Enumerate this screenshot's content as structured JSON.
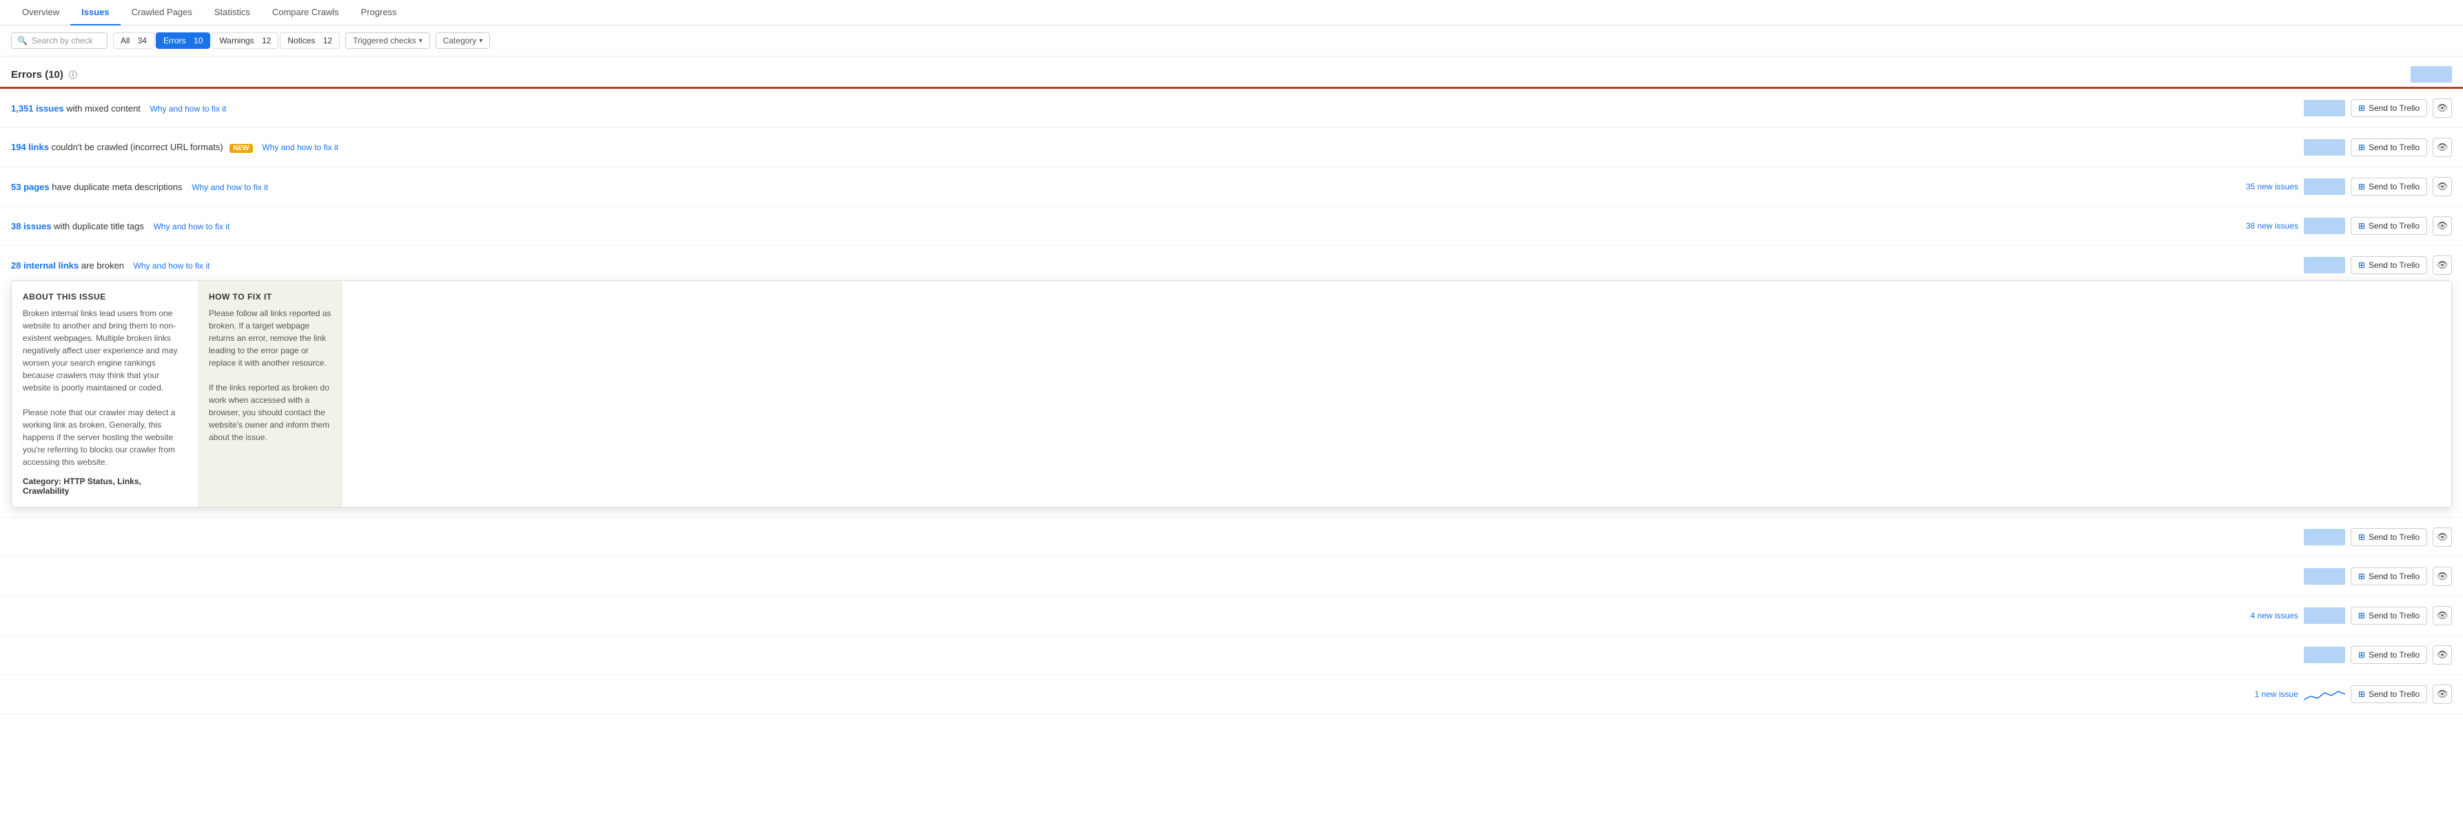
{
  "nav": {
    "tabs": [
      {
        "label": "Overview",
        "active": false
      },
      {
        "label": "Issues",
        "active": true
      },
      {
        "label": "Crawled Pages",
        "active": false
      },
      {
        "label": "Statistics",
        "active": false
      },
      {
        "label": "Compare Crawls",
        "active": false
      },
      {
        "label": "Progress",
        "active": false
      }
    ]
  },
  "filters": {
    "search_placeholder": "Search by check",
    "all_label": "All",
    "all_count": "34",
    "errors_label": "Errors",
    "errors_count": "10",
    "warnings_label": "Warnings",
    "warnings_count": "12",
    "notices_label": "Notices",
    "notices_count": "12",
    "triggered_label": "Triggered checks",
    "category_label": "Category"
  },
  "section": {
    "title": "Errors",
    "count": "(10)"
  },
  "issues": [
    {
      "id": "mixed-content",
      "count_text": "1,351 issues",
      "desc": "with mixed content",
      "fix_text": "Why and how to fix it",
      "new_issues": "",
      "has_badge": false
    },
    {
      "id": "incorrect-url",
      "count_text": "194 links",
      "desc": "couldn't be crawled (incorrect URL formats)",
      "fix_text": "Why and how to fix it",
      "new_issues": "",
      "has_badge": true,
      "badge_text": "NEW"
    },
    {
      "id": "duplicate-meta",
      "count_text": "53 pages",
      "desc": "have duplicate meta descriptions",
      "fix_text": "Why and how to fix it",
      "new_issues": "35 new issues",
      "has_badge": false
    },
    {
      "id": "duplicate-title",
      "count_text": "38 issues",
      "desc": "with duplicate title tags",
      "fix_text": "Why and how to fix it",
      "new_issues": "38 new issues",
      "has_badge": false
    },
    {
      "id": "broken-links",
      "count_text": "28 internal links",
      "desc": "are broken",
      "fix_text": "Why and how to fix it",
      "new_issues": "",
      "has_badge": false,
      "has_tooltip": true
    },
    {
      "id": "issue6",
      "count_text": "",
      "desc": "",
      "fix_text": "",
      "new_issues": "",
      "has_badge": false
    },
    {
      "id": "issue7",
      "count_text": "",
      "desc": "",
      "fix_text": "",
      "new_issues": "",
      "has_badge": false
    },
    {
      "id": "issue8",
      "count_text": "",
      "desc": "",
      "fix_text": "",
      "new_issues": "4 new issues",
      "has_badge": false
    },
    {
      "id": "issue9",
      "count_text": "",
      "desc": "",
      "fix_text": "",
      "new_issues": "",
      "has_badge": false
    },
    {
      "id": "issue10",
      "count_text": "",
      "desc": "",
      "fix_text": "",
      "new_issues": "1 new issue",
      "has_badge": false
    }
  ],
  "tooltip": {
    "about_title": "ABOUT THIS ISSUE",
    "about_text": "Broken internal links lead users from one website to another and bring them to non-existent webpages. Multiple broken links negatively affect user experience and may worsen your search engine rankings because crawlers may think that your website is poorly maintained or coded.\nPlease note that our crawler may detect a working link as broken. Generally, this happens if the server hosting the website you're referring to blocks our crawler from accessing this website.",
    "category_label": "Category:",
    "category_value": "HTTP Status, Links, Crawlability",
    "how_title": "HOW TO FIX IT",
    "how_text": "Please follow all links reported as broken. If a target webpage returns an error, remove the link leading to the error page or replace it with another resource.\nIf the links reported as broken do work when accessed with a browser, you should contact the website's owner and inform them about the issue."
  },
  "buttons": {
    "send_to_trello": "Send to Trello",
    "triggered_checks": "Triggered checks",
    "category": "Category"
  }
}
